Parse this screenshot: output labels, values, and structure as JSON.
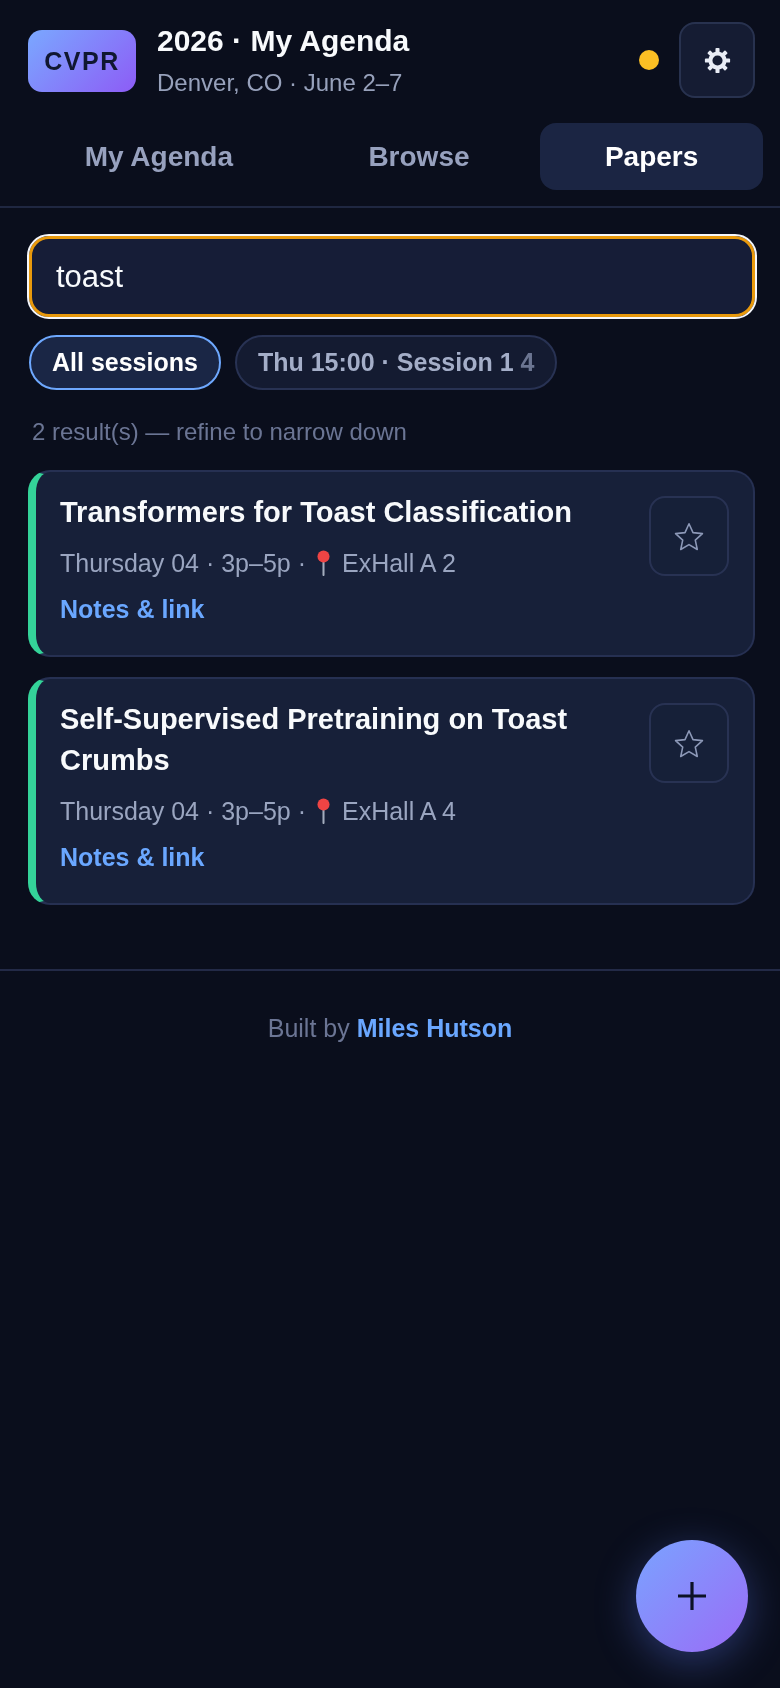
{
  "header": {
    "logo": "CVPR",
    "title": "2026 · My Agenda",
    "subtitle": "Denver, CO · June 2–7",
    "status_dot": {
      "color": "#fbbf24"
    }
  },
  "tabs": [
    {
      "label": "My Agenda",
      "selected": false
    },
    {
      "label": "Browse",
      "selected": false
    },
    {
      "label": "Papers",
      "selected": true
    }
  ],
  "search": {
    "value": "toast",
    "focused": true
  },
  "filters": [
    {
      "label": "All sessions",
      "selected": true
    },
    {
      "label": "Thu 15:00 · Session 1",
      "count": "4",
      "selected": false
    }
  ],
  "results_summary": "2 result(s) — refine to narrow down",
  "results": [
    {
      "title": "Transformers for Toast Classification",
      "when": "Thursday 04 · 3p–5p ·",
      "room": "ExHall A 2",
      "link": "Notes & link",
      "starred": false,
      "color": "#34d399"
    },
    {
      "title": "Self-Supervised Pretraining on Toast Crumbs",
      "when": "Thursday 04 · 3p–5p ·",
      "room": "ExHall A 4",
      "link": "Notes & link",
      "starred": false,
      "color": "#34d399"
    }
  ],
  "footer": {
    "text": "Built by",
    "link": "Miles Hutson"
  }
}
